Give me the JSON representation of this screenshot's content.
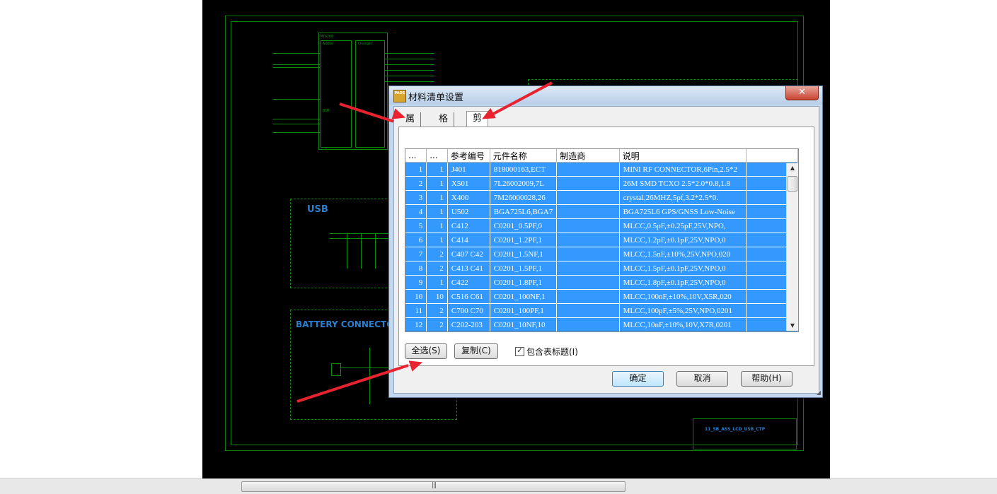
{
  "schematic": {
    "usb_label": "USB",
    "battery_label": "BATTERY CONNECTOR",
    "title_block": "11_SB_ASS_LCD_USB_CTP",
    "chip_title": "MT6260",
    "chip_section_audio": "Audio",
    "chip_section_charger": "Charger",
    "chip_section_bsm": "BSM"
  },
  "dialog": {
    "title": "材料清单设置",
    "icon_text": "PADS",
    "close_glyph": "✕",
    "tabs": [
      "属性",
      "格式",
      "剪贴板视图"
    ],
    "active_tab": 2,
    "columns": [
      "...",
      "...",
      "参考编号",
      "元件名称",
      "制造商",
      "说明"
    ],
    "rows": [
      [
        "1",
        "1",
        "J401",
        "818000163,ECT",
        "",
        "MINI RF CONNECTOR,6Pin,2.5*2"
      ],
      [
        "2",
        "1",
        "X501",
        "7L26002009,7L",
        "",
        "26M SMD TCXO 2.5*2.0*0.8,1.8"
      ],
      [
        "3",
        "1",
        "X400",
        "7M26000028,26",
        "",
        "crystal,26MHZ,5pf,3.2*2.5*0."
      ],
      [
        "4",
        "1",
        "U502",
        "BGA725L6,BGA7",
        "",
        "BGA725L6  GPS/GNSS Low-Noise"
      ],
      [
        "5",
        "1",
        "C412",
        "C0201_0.5PF,0",
        "",
        "MLCC,0.5pF,±0.25pF,25V,NPO,"
      ],
      [
        "6",
        "1",
        "C414",
        "C0201_1.2PF,1",
        "",
        "MLCC,1.2pF,±0.1pF,25V,NPO,0"
      ],
      [
        "7",
        "2",
        "C407 C42",
        "C0201_1.5NF,1",
        "",
        "MLCC,1.5nF,±10%,25V,NPO,020"
      ],
      [
        "8",
        "2",
        "C413 C41",
        "C0201_1.5PF,1",
        "",
        "MLCC,1.5pF,±0.1pF,25V,NPO,0"
      ],
      [
        "9",
        "1",
        "C422",
        "C0201_1.8PF,1",
        "",
        "MLCC,1.8pF,±0.1pF,25V,NPO,0"
      ],
      [
        "10",
        "10",
        "C516 C61",
        "C0201_100NF,1",
        "",
        "MLCC,100nF,±10%,10V,X5R,020"
      ],
      [
        "11",
        "2",
        "C700 C70",
        "C0201_100PF,1",
        "",
        "MLCC,100pF,±5%,25V,NPO,0201"
      ],
      [
        "12",
        "2",
        "C202-203",
        "C0201_10NF,10",
        "",
        "MLCC,10nF,±10%,10V,X7R,0201"
      ]
    ],
    "select_all": "全选(S)",
    "copy": "复制(C)",
    "include_header": "包含表标题(I)",
    "include_header_checked": true,
    "ok": "确定",
    "cancel": "取消",
    "help": "帮助(H)"
  },
  "scrollbar": {
    "grip": "|||"
  },
  "colors": {
    "selection": "#3399ff",
    "arrow": "#e8232f",
    "schematic_green": "#0a7a0a",
    "label_blue": "#2b7fd0"
  }
}
